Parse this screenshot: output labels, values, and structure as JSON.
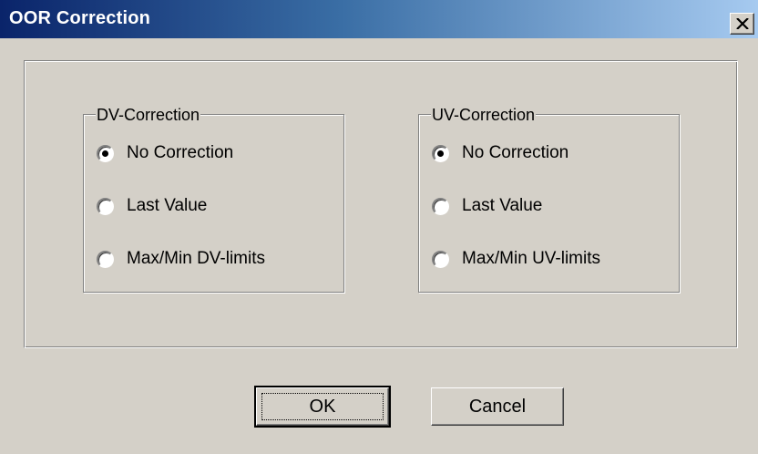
{
  "window": {
    "title": "OOR Correction",
    "close_icon": "close-x-icon"
  },
  "dv_group": {
    "legend": "DV-Correction",
    "options": [
      {
        "label": "No Correction",
        "checked": true
      },
      {
        "label": "Last Value",
        "checked": false
      },
      {
        "label": "Max/Min DV-limits",
        "checked": false
      }
    ]
  },
  "uv_group": {
    "legend": "UV-Correction",
    "options": [
      {
        "label": "No Correction",
        "checked": true
      },
      {
        "label": "Last Value",
        "checked": false
      },
      {
        "label": "Max/Min UV-limits",
        "checked": false
      }
    ]
  },
  "buttons": {
    "ok": "OK",
    "cancel": "Cancel"
  },
  "colors": {
    "face": "#d4d0c8",
    "title_start": "#0a246a",
    "title_end": "#a6caf0"
  }
}
